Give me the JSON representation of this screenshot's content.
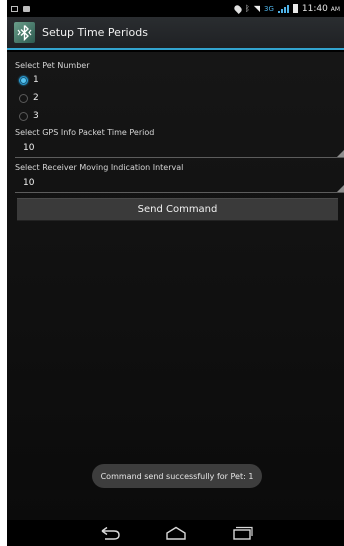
{
  "status_bar": {
    "time": "11:40",
    "ampm": "AM",
    "network": "3G",
    "icons": [
      "screen-icon",
      "chat-icon",
      "location-icon",
      "bluetooth-icon",
      "wifi-icon",
      "signal-icon",
      "battery-icon"
    ]
  },
  "action_bar": {
    "title": "Setup Time Periods",
    "app_icon": "bluetooth-app-icon",
    "accent_color": "#33a4cf"
  },
  "pet": {
    "label": "Select Pet Number",
    "options": [
      "1",
      "2",
      "3"
    ],
    "selected": "1"
  },
  "gps": {
    "label": "Select GPS Info Packet Time Period",
    "value": "10"
  },
  "receiver": {
    "label": "Select Receiver Moving Indication Interval",
    "value": "10"
  },
  "send_button": {
    "label": "Send Command"
  },
  "toast": {
    "message": "Command send successfully for Pet: 1"
  },
  "nav_bar": {
    "buttons": [
      "back-icon",
      "home-icon",
      "recents-icon"
    ]
  }
}
